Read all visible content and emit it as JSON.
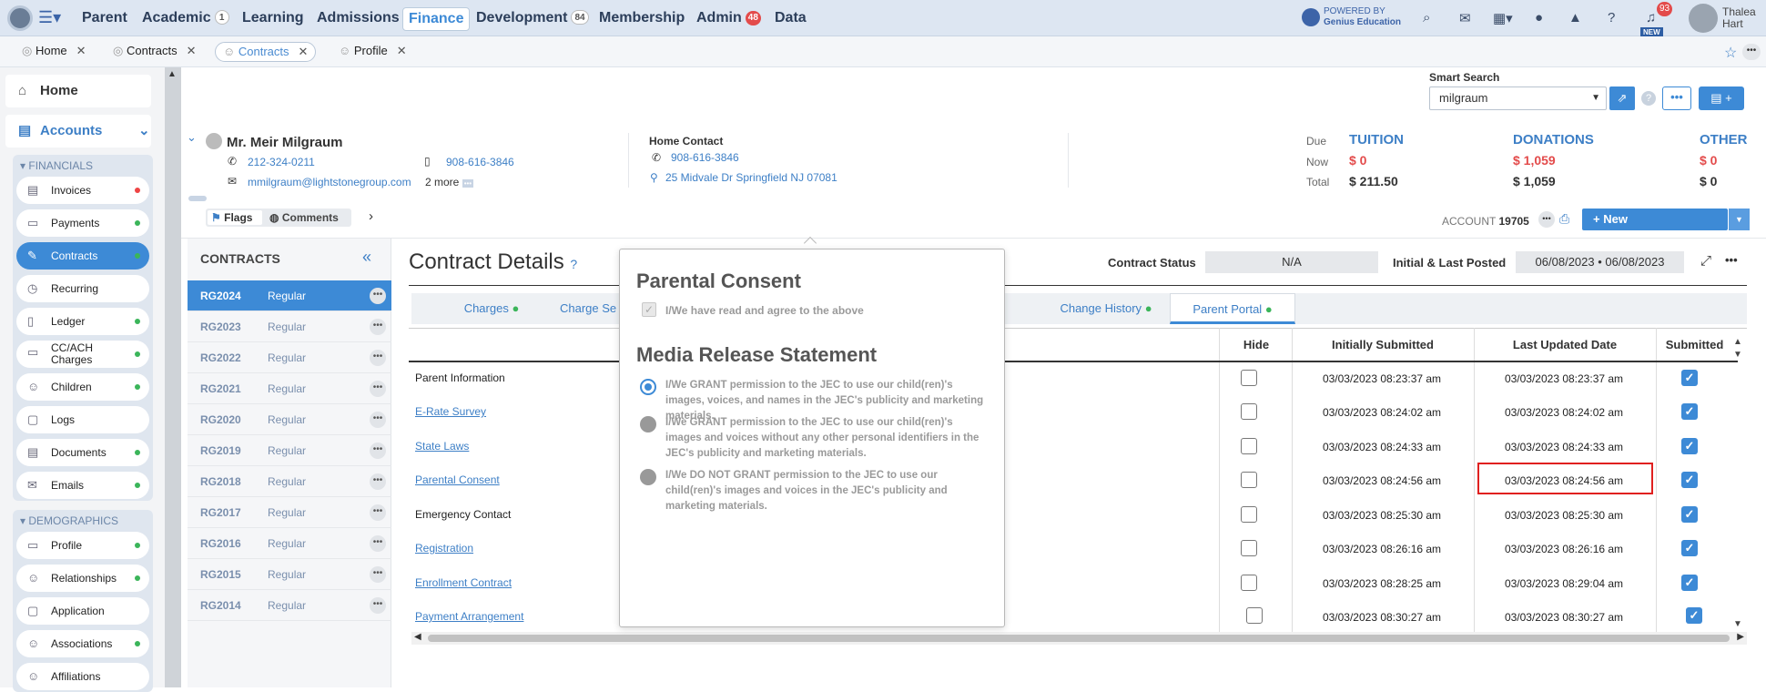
{
  "nav": {
    "items": [
      {
        "label": "Parent"
      },
      {
        "label": "Academic",
        "badge": "1"
      },
      {
        "label": "Learning"
      },
      {
        "label": "Admissions"
      },
      {
        "label": "Finance"
      },
      {
        "label": "Development",
        "badge": "84"
      },
      {
        "label": "Membership"
      },
      {
        "label": "Admin",
        "badge": "48"
      },
      {
        "label": "Data"
      }
    ],
    "powered_by_line1": "POWERED BY",
    "powered_by_line2": "Genius Education",
    "notif_count": "93",
    "new_label": "NEW",
    "user_first": "Thalea",
    "user_last": "Hart"
  },
  "tabs": [
    {
      "label": "Home"
    },
    {
      "label": "Contracts"
    },
    {
      "label": "Contracts"
    },
    {
      "label": "Profile"
    }
  ],
  "sidebar": {
    "home": "Home",
    "accounts": "Accounts",
    "financials_heading": "FINANCIALS",
    "financials": [
      {
        "label": "Invoices",
        "status": "red"
      },
      {
        "label": "Payments",
        "status": "green"
      },
      {
        "label": "Contracts",
        "status": "green"
      },
      {
        "label": "Recurring",
        "status": ""
      },
      {
        "label": "Ledger",
        "status": "green"
      },
      {
        "label": "CC/ACH Charges",
        "status": "green"
      },
      {
        "label": "Children",
        "status": "green"
      },
      {
        "label": "Logs",
        "status": ""
      },
      {
        "label": "Documents",
        "status": "green"
      },
      {
        "label": "Emails",
        "status": "green"
      }
    ],
    "demographics_heading": "DEMOGRAPHICS",
    "demographics": [
      {
        "label": "Profile",
        "status": "green"
      },
      {
        "label": "Relationships",
        "status": "green"
      },
      {
        "label": "Application",
        "status": ""
      },
      {
        "label": "Associations",
        "status": "green"
      },
      {
        "label": "Affiliations",
        "status": ""
      }
    ]
  },
  "search": {
    "label": "Smart Search",
    "value": "milgraum"
  },
  "contact": {
    "name": "Mr. Meir Milgraum",
    "phone1": "212-324-0211",
    "mobile": "908-616-3846",
    "email": "mmilgraum@lightstonegroup.com",
    "more": "2 more",
    "home_contact_label": "Home Contact",
    "home_phone": "908-616-3846",
    "address": "25 Midvale Dr Springfield NJ 07081"
  },
  "balances": {
    "row_labels": [
      "Due",
      "Now",
      "Total"
    ],
    "tuition_label": "TUITION",
    "tuition_now": "$ 0",
    "tuition_total": "$ 211.50",
    "donations_label": "DONATIONS",
    "donations_now": "$ 1,059",
    "donations_total": "$ 1,059",
    "other_label": "OTHER",
    "other_now": "$ 0",
    "other_total": "$ 0"
  },
  "flags_label": "Flags",
  "comments_label": "Comments",
  "account_label": "ACCOUNT",
  "account_number": "19705",
  "new_button": "New",
  "contracts": {
    "heading": "CONTRACTS",
    "rows": [
      {
        "code": "RG2024",
        "type": "Regular"
      },
      {
        "code": "RG2023",
        "type": "Regular"
      },
      {
        "code": "RG2022",
        "type": "Regular"
      },
      {
        "code": "RG2021",
        "type": "Regular"
      },
      {
        "code": "RG2020",
        "type": "Regular"
      },
      {
        "code": "RG2019",
        "type": "Regular"
      },
      {
        "code": "RG2018",
        "type": "Regular"
      },
      {
        "code": "RG2017",
        "type": "Regular"
      },
      {
        "code": "RG2016",
        "type": "Regular"
      },
      {
        "code": "RG2015",
        "type": "Regular"
      },
      {
        "code": "RG2014",
        "type": "Regular"
      }
    ]
  },
  "details": {
    "title": "Contract Details",
    "status_label": "Contract Status",
    "status_value": "N/A",
    "posted_label": "Initial & Last Posted",
    "posted_value": "06/08/2023 • 06/08/2023",
    "tabs": [
      "Charges",
      "Charge Se",
      "Change History",
      "Parent Portal"
    ],
    "columns": [
      "Hide",
      "Initially Submitted",
      "Last Updated Date",
      "Submitted"
    ],
    "rows": [
      {
        "label": "Parent Information",
        "link": false,
        "initial": "03/03/2023 08:23:37 am",
        "updated": "03/03/2023 08:23:37 am"
      },
      {
        "label": "E-Rate Survey",
        "link": true,
        "initial": "03/03/2023 08:24:02 am",
        "updated": "03/03/2023 08:24:02 am"
      },
      {
        "label": "State Laws",
        "link": true,
        "initial": "03/03/2023 08:24:33 am",
        "updated": "03/03/2023 08:24:33 am"
      },
      {
        "label": "Parental Consent",
        "link": true,
        "initial": "03/03/2023 08:24:56 am",
        "updated": "03/03/2023 08:24:56 am"
      },
      {
        "label": "Emergency Contact",
        "link": false,
        "initial": "03/03/2023 08:25:30 am",
        "updated": "03/03/2023 08:25:30 am"
      },
      {
        "label": "Registration",
        "link": true,
        "initial": "03/03/2023 08:26:16 am",
        "updated": "03/03/2023 08:26:16 am"
      },
      {
        "label": "Enrollment Contract",
        "link": true,
        "initial": "03/03/2023 08:28:25 am",
        "updated": "03/03/2023 08:29:04 am"
      },
      {
        "label": "Payment Arrangement",
        "link": true,
        "initial": "03/03/2023 08:30:27 am",
        "updated": "03/03/2023 08:30:27 am"
      }
    ]
  },
  "popup": {
    "title": "Parental Consent",
    "agree": "I/We have read and agree to the above",
    "media_title": "Media Release Statement",
    "options": [
      "I/We GRANT permission to the JEC to use our child(ren)'s images, voices, and names in the JEC's publicity and marketing materials.",
      "I/We GRANT permission to the JEC to use our child(ren)'s images and voices without any other personal identifiers in the JEC's publicity and marketing materials.",
      "I/We DO NOT GRANT permission to the JEC to use our child(ren)'s images and voices in the JEC's publicity and marketing materials."
    ]
  },
  "colors": {
    "accent": "#3d8ad6",
    "highlight": "#e0201f"
  }
}
